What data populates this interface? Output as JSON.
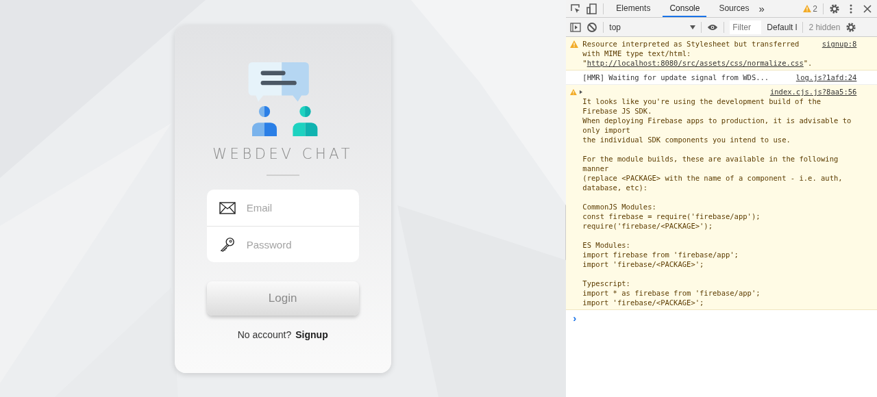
{
  "login": {
    "brand": "WEBDEV CHAT",
    "fields": [
      {
        "kind": "email",
        "placeholder": "Email"
      },
      {
        "kind": "password",
        "placeholder": "Password"
      }
    ],
    "button": "Login",
    "prompt": "No account?",
    "link": "Signup"
  },
  "devtools": {
    "tabs": [
      {
        "label": "Elements",
        "selected": false
      },
      {
        "label": "Console",
        "selected": true
      },
      {
        "label": "Sources",
        "selected": false
      }
    ],
    "more": "»",
    "warning_count": "2",
    "context": "top",
    "filter": {
      "placeholder": "Filter"
    },
    "levels": "Default l",
    "hidden": "2 hidden",
    "messages": [
      {
        "kind": "warning",
        "expandable": false,
        "source": "signup:8",
        "text": "Resource interpreted as Stylesheet but transferred with MIME type text/html: \"",
        "link": "http://localhost:8080/src/assets/css/normalize.css",
        "end": "\"."
      },
      {
        "kind": "info",
        "expandable": false,
        "source": "log.js?1afd:24",
        "text": "[HMR] Waiting for update signal from WDS..."
      },
      {
        "kind": "warning",
        "expandable": true,
        "source": "index.cjs.js?8aa5:56",
        "text": "It looks like you're using the development build of the Firebase JS SDK.\nWhen deploying Firebase apps to production, it is advisable to only import\nthe individual SDK components you intend to use.\n\nFor the module builds, these are available in the following manner\n(replace <PACKAGE> with the name of a component - i.e. auth, database, etc):\n\nCommonJS Modules:\nconst firebase = require('firebase/app');\nrequire('firebase/<PACKAGE>');\n\nES Modules:\nimport firebase from 'firebase/app';\nimport 'firebase/<PACKAGE>';\n\nTypescript:\nimport * as firebase from 'firebase/app';\nimport 'firebase/<PACKAGE>';"
      }
    ],
    "prompt": "›"
  }
}
